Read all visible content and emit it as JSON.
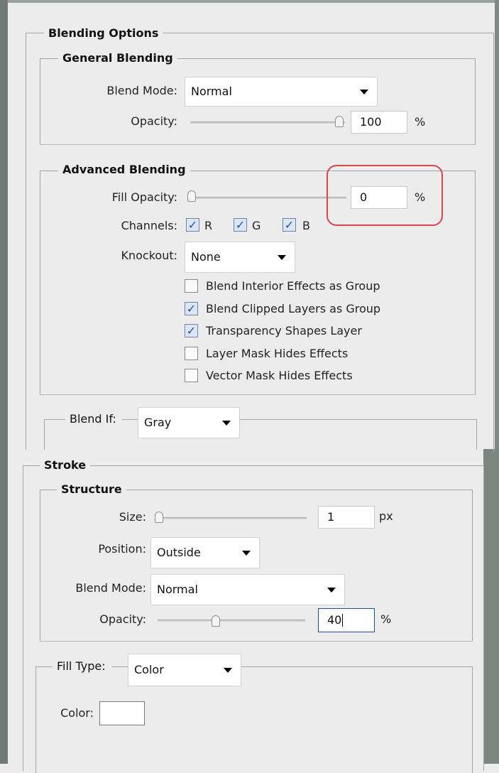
{
  "blending_options": {
    "title": "Blending Options",
    "general": {
      "title": "General Blending",
      "blend_mode_label": "Blend Mode:",
      "blend_mode_value": "Normal",
      "opacity_label": "Opacity:",
      "opacity_value": "100",
      "opacity_unit": "%",
      "opacity_level": 1.0
    },
    "advanced": {
      "title": "Advanced Blending",
      "fill_opacity_label": "Fill Opacity:",
      "fill_opacity_value": "0",
      "fill_opacity_unit": "%",
      "fill_opacity_level": 0.0,
      "channels_label": "Channels:",
      "channels": [
        {
          "label": "R",
          "checked": true
        },
        {
          "label": "G",
          "checked": true
        },
        {
          "label": "B",
          "checked": true
        }
      ],
      "knockout_label": "Knockout:",
      "knockout_value": "None",
      "options": [
        {
          "label": "Blend Interior Effects as Group",
          "checked": false
        },
        {
          "label": "Blend Clipped Layers as Group",
          "checked": true
        },
        {
          "label": "Transparency Shapes Layer",
          "checked": true
        },
        {
          "label": "Layer Mask Hides Effects",
          "checked": false
        },
        {
          "label": "Vector Mask Hides Effects",
          "checked": false
        }
      ]
    },
    "blend_if": {
      "label": "Blend If:",
      "value": "Gray"
    }
  },
  "stroke": {
    "title": "Stroke",
    "structure": {
      "title": "Structure",
      "size_label": "Size:",
      "size_value": "1",
      "size_unit": "px",
      "size_level": 0.0,
      "position_label": "Position:",
      "position_value": "Outside",
      "blend_mode_label": "Blend Mode:",
      "blend_mode_value": "Normal",
      "opacity_label": "Opacity:",
      "opacity_value": "40",
      "opacity_unit": "%",
      "opacity_level": 0.4
    },
    "fill": {
      "fill_type_label": "Fill Type:",
      "fill_type_value": "Color",
      "color_label": "Color:",
      "color_value": "#ffffff"
    }
  },
  "colors": {
    "highlight": "#d8454d",
    "check": "#2b4f99",
    "panel_bg": "#ececec"
  }
}
